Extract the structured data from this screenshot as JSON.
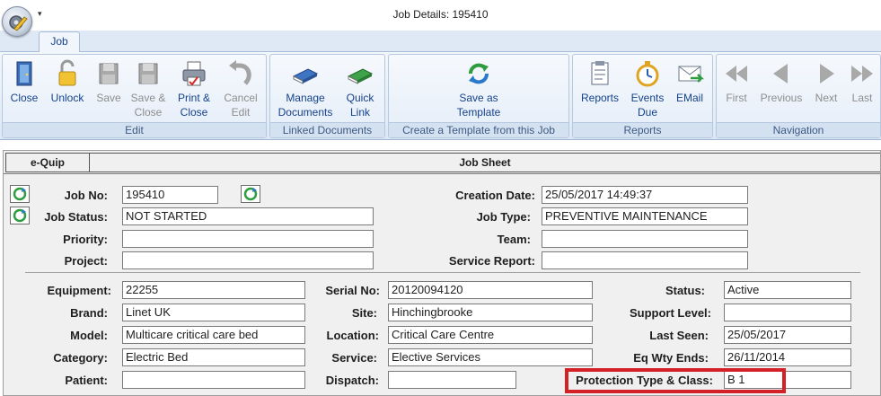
{
  "window": {
    "title": "Job Details: 195410"
  },
  "tabs": [
    {
      "label": "Job"
    }
  ],
  "ribbon": {
    "groups": {
      "edit": "Edit",
      "linked": "Linked Documents",
      "template": "Create a Template from this Job",
      "reports": "Reports",
      "navigation": "Navigation"
    },
    "buttons": {
      "close": [
        "Close",
        ""
      ],
      "unlock": [
        "Unlock",
        ""
      ],
      "save": [
        "Save",
        ""
      ],
      "save_close": [
        "Save &",
        "Close"
      ],
      "print_close": [
        "Print &",
        "Close"
      ],
      "cancel_edit": [
        "Cancel",
        "Edit"
      ],
      "manage_documents": [
        "Manage",
        "Documents"
      ],
      "quick_link": [
        "Quick",
        "Link"
      ],
      "save_template": [
        "Save as",
        "Template"
      ],
      "reports": [
        "Reports",
        ""
      ],
      "events_due": [
        "Events",
        "Due"
      ],
      "email": [
        "EMail",
        ""
      ],
      "first": [
        "First",
        ""
      ],
      "previous": [
        "Previous",
        ""
      ],
      "next": [
        "Next",
        ""
      ],
      "last": [
        "Last",
        ""
      ]
    }
  },
  "sheet": {
    "module_tab": "e-Quip",
    "title": "Job Sheet",
    "top": {
      "job_no": {
        "label": "Job No:",
        "value": "195410"
      },
      "job_status": {
        "label": "Job Status:",
        "value": "NOT STARTED"
      },
      "priority": {
        "label": "Priority:",
        "value": ""
      },
      "project": {
        "label": "Project:",
        "value": ""
      },
      "creation_date": {
        "label": "Creation Date:",
        "value": "25/05/2017 14:49:37"
      },
      "job_type": {
        "label": "Job Type:",
        "value": "PREVENTIVE MAINTENANCE"
      },
      "team": {
        "label": "Team:",
        "value": ""
      },
      "service_report": {
        "label": "Service Report:",
        "value": ""
      }
    },
    "equipment": {
      "equipment": {
        "label": "Equipment:",
        "value": "22255"
      },
      "brand": {
        "label": "Brand:",
        "value": "Linet UK"
      },
      "model": {
        "label": "Model:",
        "value": "Multicare critical care bed"
      },
      "category": {
        "label": "Category:",
        "value": "Electric Bed"
      },
      "patient": {
        "label": "Patient:",
        "value": ""
      },
      "serial_no": {
        "label": "Serial No:",
        "value": "20120094120"
      },
      "site": {
        "label": "Site:",
        "value": "Hinchingbrooke"
      },
      "location": {
        "label": "Location:",
        "value": "Critical Care Centre"
      },
      "service": {
        "label": "Service:",
        "value": "Elective Services"
      },
      "dispatch": {
        "label": "Dispatch:",
        "value": ""
      },
      "status": {
        "label": "Status:",
        "value": "Active"
      },
      "support_level": {
        "label": "Support Level:",
        "value": ""
      },
      "last_seen": {
        "label": "Last Seen:",
        "value": "25/05/2017"
      },
      "eq_wty_ends": {
        "label": "Eq Wty Ends:",
        "value": "26/11/2014"
      },
      "protection": {
        "label": "Protection Type & Class:",
        "value": "B 1"
      }
    }
  },
  "colors": {
    "highlight": "#d42027",
    "ribbon_text": "#15428b"
  }
}
